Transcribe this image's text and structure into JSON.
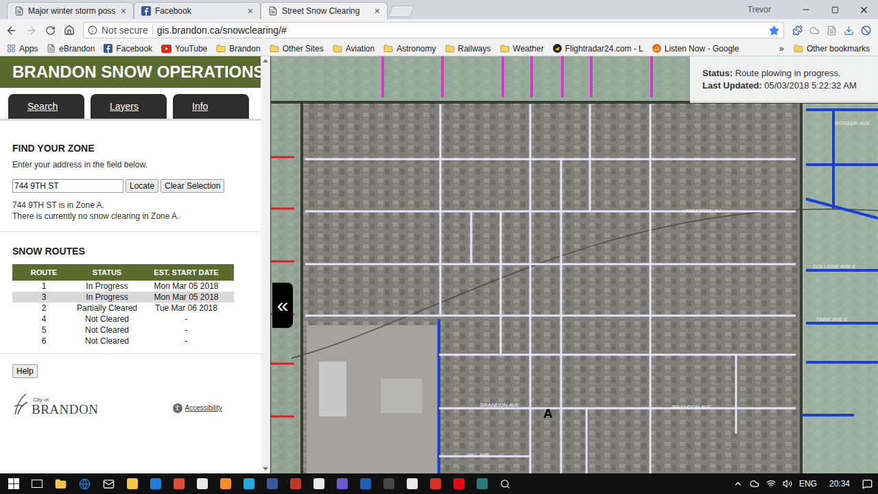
{
  "browser": {
    "tabs": [
      {
        "label": "Major winter storm poss",
        "kind": "page",
        "selected": false
      },
      {
        "label": "Facebook",
        "kind": "facebook",
        "selected": false
      },
      {
        "label": "Street Snow Clearing",
        "kind": "page",
        "selected": true
      }
    ],
    "close_glyph": "×",
    "user": "Trevor",
    "security": "Not secure",
    "url": "gis.brandon.ca/snowclearing/#",
    "bookmarks": [
      {
        "label": "Apps",
        "kind": "apps"
      },
      {
        "label": "eBrandon",
        "kind": "page"
      },
      {
        "label": "Facebook",
        "kind": "facebook"
      },
      {
        "label": "YouTube",
        "kind": "youtube"
      },
      {
        "label": "Brandon",
        "kind": "folder"
      },
      {
        "label": "Other Sites",
        "kind": "folder"
      },
      {
        "label": "Aviation",
        "kind": "folder"
      },
      {
        "label": "Astronomy",
        "kind": "folder"
      },
      {
        "label": "Railways",
        "kind": "folder"
      },
      {
        "label": "Weather",
        "kind": "folder"
      },
      {
        "label": "Flightradar24.com - L",
        "kind": "flightradar"
      },
      {
        "label": "Listen Now - Google",
        "kind": "music"
      }
    ],
    "more": "»",
    "other_bookmarks": "Other bookmarks"
  },
  "app": {
    "title": "BRANDON SNOW OPERATIONS",
    "tabs": [
      "Search",
      "Layers",
      "Info"
    ],
    "find_zone": {
      "heading": "FIND YOUR ZONE",
      "hint": "Enter your address in the field below.",
      "address": "744 9TH ST",
      "buttons": [
        "Locate",
        "Clear Selection"
      ],
      "results": [
        "744 9TH ST is in Zone A.",
        "There is currently no snow clearing in Zone A."
      ]
    },
    "snow_routes": {
      "heading": "SNOW ROUTES",
      "columns": [
        "ROUTE",
        "STATUS",
        "EST. START DATE"
      ],
      "rows": [
        {
          "route": "1",
          "status": "In Progress",
          "date": "Mon Mar 05 2018",
          "selected": false
        },
        {
          "route": "3",
          "status": "In Progress",
          "date": "Mon Mar 05 2018",
          "selected": true
        },
        {
          "route": "2",
          "status": "Partially Cleared",
          "date": "Tue Mar 06 2018",
          "selected": false
        },
        {
          "route": "4",
          "status": "Not Cleared",
          "date": "-",
          "selected": false
        },
        {
          "route": "5",
          "status": "Not Cleared",
          "date": "-",
          "selected": false
        },
        {
          "route": "6",
          "status": "Not Cleared",
          "date": "-",
          "selected": false
        }
      ]
    },
    "help": "Help",
    "logo": {
      "small": "City of",
      "name": "BRANDON"
    },
    "accessibility": "Accessibility",
    "collapse": "«"
  },
  "map": {
    "status_label": "Status:",
    "status": "Route plowing in progress.",
    "updated_label": "Last Updated:",
    "updated": "05/03/2018 5:22:32 AM",
    "marker": "A",
    "street_labels": [
      "VANHORNE AV",
      "BRANDON AVE",
      "BRANDON AVE",
      "HILL AVE",
      "ROSSER AVE",
      "COLLEGE AVE E",
      "PARK AVE E"
    ]
  },
  "taskbar": {
    "language": "ENG",
    "time": "20:34"
  }
}
